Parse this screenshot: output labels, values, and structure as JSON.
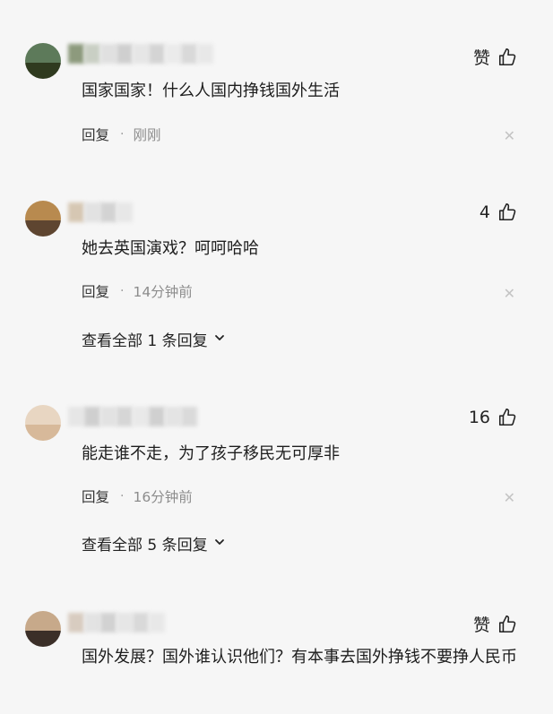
{
  "colors": {
    "background": "#f6f6f6",
    "text": "#1e1e1e",
    "time_text": "#8c8c8c",
    "close_icon": "#c4c4c4"
  },
  "comments": [
    {
      "like_label": "赞",
      "text": "国家国家！什么人国内挣钱国外生活",
      "reply_label": "回复",
      "separator": "·",
      "time": "刚刚",
      "close_icon": "close-icon"
    },
    {
      "like_label": "4",
      "text": "她去英国演戏？呵呵哈哈",
      "reply_label": "回复",
      "separator": "·",
      "time": "14分钟前",
      "close_icon": "close-icon",
      "view_all": "查看全部 1 条回复"
    },
    {
      "like_label": "16",
      "text": "能走谁不走，为了孩子移民无可厚非",
      "reply_label": "回复",
      "separator": "·",
      "time": "16分钟前",
      "close_icon": "close-icon",
      "view_all": "查看全部 5 条回复"
    },
    {
      "like_label": "赞",
      "text": "国外发展？国外谁认识他们？有本事去国外挣钱不要挣人民币"
    }
  ],
  "icons": {
    "like": "thumbs-up-icon",
    "expand": "chevron-down-icon",
    "close": "close-icon"
  }
}
